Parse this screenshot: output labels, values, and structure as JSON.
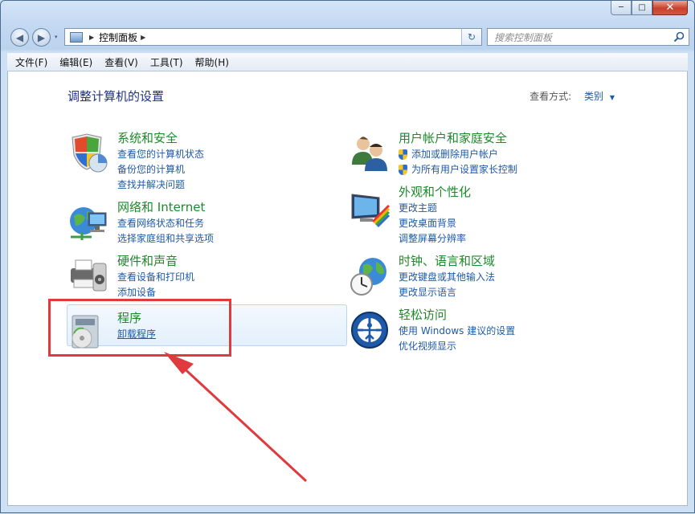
{
  "window": {
    "minimize_symbol": "─",
    "maximize_symbol": "□",
    "close_symbol": "✕"
  },
  "nav": {
    "back_symbol": "◀",
    "forward_symbol": "▶",
    "dropdown_symbol": "▾",
    "refresh_symbol": "↻"
  },
  "address": {
    "path": "控制面板",
    "separator": "▶"
  },
  "search": {
    "placeholder": "搜索控制面板"
  },
  "menu": [
    "文件(F)",
    "编辑(E)",
    "查看(V)",
    "工具(T)",
    "帮助(H)"
  ],
  "page": {
    "title": "调整计算机的设置",
    "viewby_label": "查看方式:",
    "viewby_value": "类别"
  },
  "categories": [
    {
      "title": "系统和安全",
      "icon": "shield-chart-icon",
      "links": [
        "查看您的计算机状态",
        "备份您的计算机",
        "查找并解决问题"
      ]
    },
    {
      "title": "网络和 Internet",
      "icon": "globe-network-icon",
      "links": [
        "查看网络状态和任务",
        "选择家庭组和共享选项"
      ]
    },
    {
      "title": "硬件和声音",
      "icon": "printer-icon",
      "links": [
        "查看设备和打印机",
        "添加设备"
      ]
    },
    {
      "title": "程序",
      "icon": "programs-disc-icon",
      "links": [
        "卸载程序"
      ]
    },
    {
      "title": "用户帐户和家庭安全",
      "icon": "users-icon",
      "links": [
        "添加或删除用户帐户",
        "为所有用户设置家长控制"
      ]
    },
    {
      "title": "外观和个性化",
      "icon": "monitor-colors-icon",
      "links": [
        "更改主题",
        "更改桌面背景",
        "调整屏幕分辨率"
      ]
    },
    {
      "title": "时钟、语言和区域",
      "icon": "globe-clock-icon",
      "links": [
        "更改键盘或其他输入法",
        "更改显示语言"
      ]
    },
    {
      "title": "轻松访问",
      "icon": "ease-of-access-icon",
      "links": [
        "使用 Windows 建议的设置",
        "优化视频显示"
      ]
    }
  ],
  "colors": {
    "category_title": "#1c8a2a",
    "link": "#1e5aa8",
    "annotation": "#e0393e"
  }
}
